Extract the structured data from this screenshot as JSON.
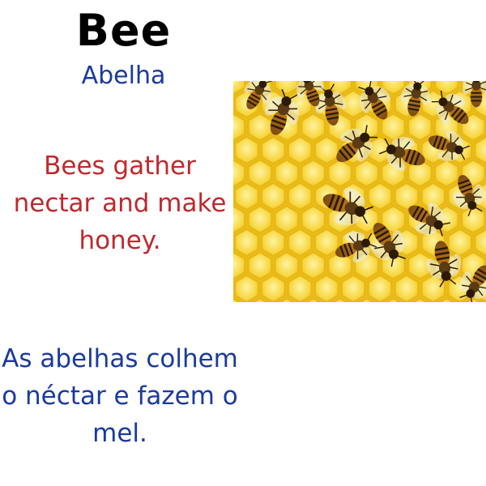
{
  "page": {
    "title": "Bee",
    "subtitle": "Abelha",
    "english_text": "Bees gather nectar and make honey.",
    "portuguese_text": "As abelhas colhem o néctar e fazem o mel."
  },
  "colors": {
    "subtitle": "#1a3a9e",
    "english": "#c0282d",
    "portuguese": "#1a3a9e",
    "honey": "#f6d23a",
    "honeycomb_wall": "#e8b915"
  },
  "image": {
    "subject": "bees-on-honeycomb-photo"
  }
}
